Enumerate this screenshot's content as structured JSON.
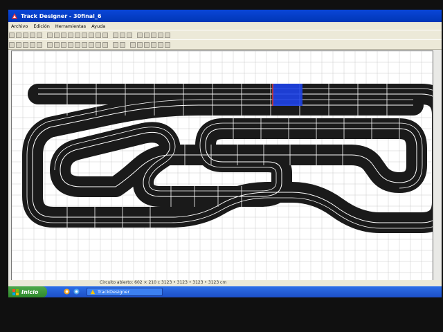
{
  "window": {
    "title": "Track Designer - 30final_6"
  },
  "menu": {
    "items": [
      "Archivo",
      "Edición",
      "Herramientas",
      "Ayuda"
    ]
  },
  "toolbar1": {
    "groups": [
      [
        "new",
        "open",
        "save",
        "print",
        "preview"
      ],
      [
        "cut",
        "copy",
        "paste",
        "delete",
        "select",
        "fill",
        "layers",
        "properties",
        "grid"
      ],
      [
        "zoom-in",
        "zoom-out",
        "zoom-grid"
      ],
      [
        "rotate-left",
        "rotate-right",
        "arrow-up",
        "arrow-left",
        "arrow-right"
      ]
    ]
  },
  "toolbar2": {
    "groups": [
      [
        "lane-change",
        "anchor",
        "piece-a",
        "piece-b",
        "piece-c"
      ],
      [
        "straight-1",
        "straight-2",
        "straight-3",
        "straight-4",
        "straight-5",
        "curve-1",
        "curve-2",
        "curve-3",
        "curve-4"
      ],
      [
        "bridge",
        "border"
      ],
      [
        "select-tool",
        "tool-1",
        "tool-2",
        "tool-3",
        "tool-4",
        "tool-5"
      ]
    ]
  },
  "status": {
    "text": "Circuito abierto: 602 × 210 c  3123 • 3123 • 3123 • 3123 cm"
  },
  "taskbar": {
    "start_label": "Inicio",
    "task_label": "TrackDesigner"
  },
  "colors": {
    "titlebar": "#0a46d8",
    "track": "#1a1a1a",
    "lane_lines": "#ffffff",
    "selection": "#1e43e8",
    "grid": "#c9c9c9",
    "taskbar": "#245edb",
    "start_button": "#3a9a37"
  }
}
